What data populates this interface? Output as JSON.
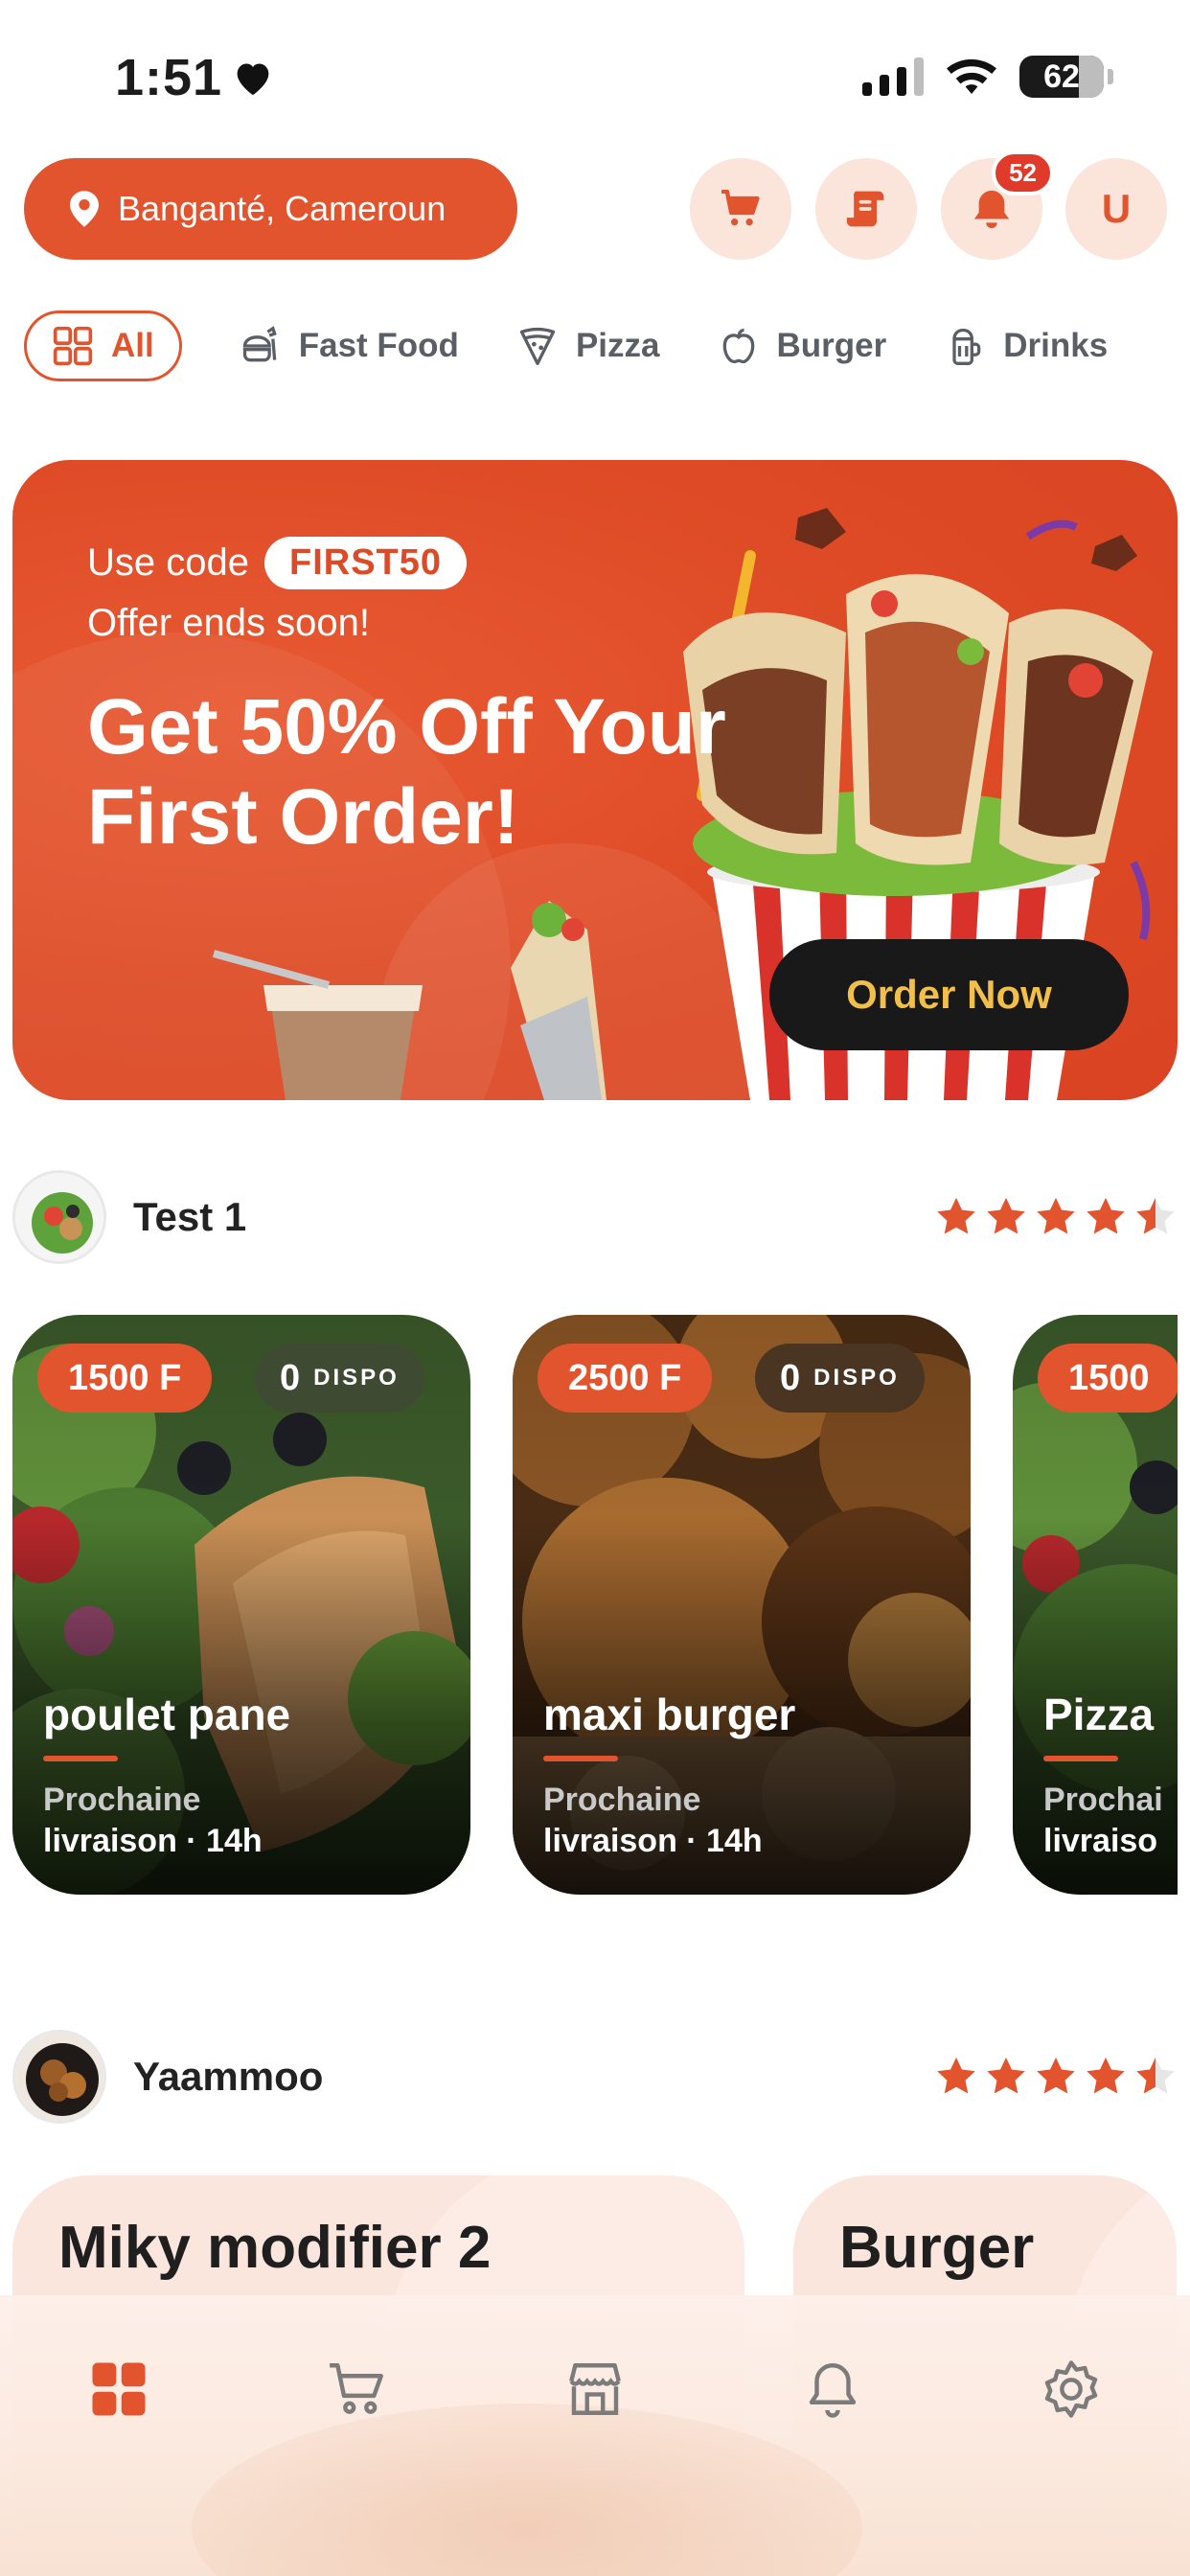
{
  "status_bar": {
    "time": "1:51",
    "battery": "62"
  },
  "header": {
    "location": "Banganté, Cameroun",
    "notifications_count": "52",
    "avatar_letter": "U"
  },
  "categories": [
    {
      "label": "All",
      "icon": "grid-icon",
      "active": true
    },
    {
      "label": "Fast Food",
      "icon": "fast-food-icon",
      "active": false
    },
    {
      "label": "Pizza",
      "icon": "pizza-icon",
      "active": false
    },
    {
      "label": "Burger",
      "icon": "apple-icon",
      "active": false
    },
    {
      "label": "Drinks",
      "icon": "drink-icon",
      "active": false
    }
  ],
  "promo": {
    "use_code_label": "Use code",
    "code": "FIRST50",
    "subtitle": "Offer ends soon!",
    "title": "Get 50% Off Your First Order!",
    "cta": "Order Now"
  },
  "sections": [
    {
      "restaurant": "Test 1",
      "rating": 4.5,
      "products": [
        {
          "price": "1500 F",
          "dispo_count": "0",
          "dispo_label": "DISPO",
          "name": "poulet pane",
          "next_label": "Prochaine",
          "delivery": "livraison · 14h"
        },
        {
          "price": "2500 F",
          "dispo_count": "0",
          "dispo_label": "DISPO",
          "name": "maxi burger",
          "next_label": "Prochaine",
          "delivery": "livraison · 14h"
        },
        {
          "price": "1500",
          "dispo_count": "",
          "dispo_label": "",
          "name": "Pizza",
          "next_label": "Prochai",
          "delivery": "livraiso"
        }
      ]
    },
    {
      "restaurant": "Yaammoo",
      "rating": 4.5,
      "menus": [
        "Miky modifier 2",
        "Burger"
      ]
    }
  ],
  "colors": {
    "accent": "#e2542d",
    "accent_soft": "#fbe4da",
    "cta_bg": "#191919",
    "cta_text": "#f2c04a"
  },
  "bottom_nav": [
    {
      "icon": "home-grid-icon",
      "active": true
    },
    {
      "icon": "cart-icon",
      "active": false
    },
    {
      "icon": "store-icon",
      "active": false
    },
    {
      "icon": "bell-icon",
      "active": false
    },
    {
      "icon": "settings-icon",
      "active": false
    }
  ]
}
